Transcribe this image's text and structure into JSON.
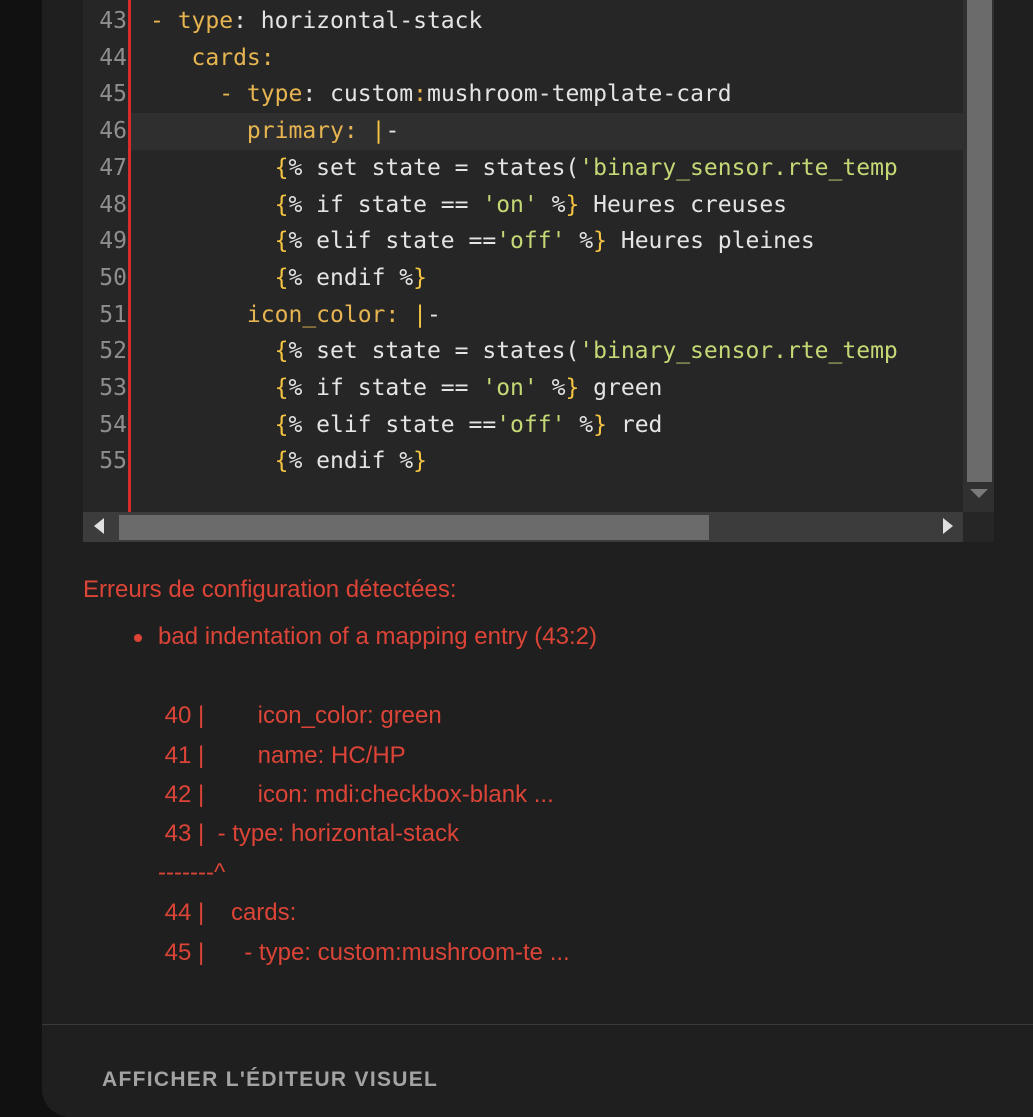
{
  "editor": {
    "lines": [
      {
        "n": "43",
        "parts": [
          {
            "t": "- ",
            "c": "k"
          },
          {
            "t": "type",
            "c": "k"
          },
          {
            "t": ": horizontal-stack",
            "c": "p"
          }
        ]
      },
      {
        "n": "44",
        "parts": [
          {
            "t": "   cards",
            "c": "k"
          },
          {
            "t": ":",
            "c": "k"
          }
        ]
      },
      {
        "n": "45",
        "parts": [
          {
            "t": "     - type",
            "c": "k"
          },
          {
            "t": ": custom",
            "c": "p"
          },
          {
            "t": ":",
            "c": "k"
          },
          {
            "t": "mushroom-template-card",
            "c": "p"
          }
        ]
      },
      {
        "n": "46",
        "parts": [
          {
            "t": "       primary",
            "c": "k"
          },
          {
            "t": ": ",
            "c": "k"
          },
          {
            "t": "|",
            "c": "b"
          },
          {
            "t": "-",
            "c": "p"
          }
        ]
      },
      {
        "n": "47",
        "parts": [
          {
            "t": "         {",
            "c": "b"
          },
          {
            "t": "% set state = states(",
            "c": "p"
          },
          {
            "t": "'binary_sensor.rte_temp",
            "c": "s"
          }
        ]
      },
      {
        "n": "48",
        "parts": [
          {
            "t": "         {",
            "c": "b"
          },
          {
            "t": "% if state == ",
            "c": "p"
          },
          {
            "t": "'on'",
            "c": "s"
          },
          {
            "t": " %",
            "c": "p"
          },
          {
            "t": "}",
            "c": "b"
          },
          {
            "t": " Heures creuses",
            "c": "p"
          }
        ]
      },
      {
        "n": "49",
        "parts": [
          {
            "t": "         {",
            "c": "b"
          },
          {
            "t": "% elif state ==",
            "c": "p"
          },
          {
            "t": "'off'",
            "c": "s"
          },
          {
            "t": " %",
            "c": "p"
          },
          {
            "t": "}",
            "c": "b"
          },
          {
            "t": " Heures pleines",
            "c": "p"
          }
        ]
      },
      {
        "n": "50",
        "parts": [
          {
            "t": "         {",
            "c": "b"
          },
          {
            "t": "% endif %",
            "c": "p"
          },
          {
            "t": "}",
            "c": "b"
          }
        ]
      },
      {
        "n": "51",
        "parts": [
          {
            "t": "       icon_color",
            "c": "k"
          },
          {
            "t": ": ",
            "c": "k"
          },
          {
            "t": "|",
            "c": "b"
          },
          {
            "t": "-",
            "c": "p"
          }
        ]
      },
      {
        "n": "52",
        "parts": [
          {
            "t": "         {",
            "c": "b"
          },
          {
            "t": "% set state = states(",
            "c": "p"
          },
          {
            "t": "'binary_sensor.rte_temp",
            "c": "s"
          }
        ]
      },
      {
        "n": "53",
        "parts": [
          {
            "t": "         {",
            "c": "b"
          },
          {
            "t": "% if state == ",
            "c": "p"
          },
          {
            "t": "'on'",
            "c": "s"
          },
          {
            "t": " %",
            "c": "p"
          },
          {
            "t": "}",
            "c": "b"
          },
          {
            "t": " green",
            "c": "p"
          }
        ]
      },
      {
        "n": "54",
        "parts": [
          {
            "t": "         {",
            "c": "b"
          },
          {
            "t": "% elif state ==",
            "c": "p"
          },
          {
            "t": "'off'",
            "c": "s"
          },
          {
            "t": " %",
            "c": "p"
          },
          {
            "t": "}",
            "c": "b"
          },
          {
            "t": " red",
            "c": "p"
          }
        ]
      },
      {
        "n": "55",
        "parts": [
          {
            "t": "         {",
            "c": "b"
          },
          {
            "t": "% endif %",
            "c": "p"
          },
          {
            "t": "}",
            "c": "b"
          }
        ]
      }
    ]
  },
  "errors": {
    "title": "Erreurs de configuration détectées:",
    "message": "bad indentation of a mapping entry (43:2)",
    "snippet": [
      " 40 |        icon_color: green",
      " 41 |        name: HC/HP",
      " 42 |        icon: mdi:checkbox-blank ...",
      " 43 |  - type: horizontal-stack",
      "-------^",
      " 44 |    cards:",
      " 45 |      - type: custom:mushroom-te ..."
    ]
  },
  "footer": {
    "visual_editor_label": "AFFICHER L'ÉDITEUR VISUEL"
  },
  "colors": {
    "error": "#db4437",
    "gutter_error": "#d92b2b",
    "yaml_key": "#e6b450",
    "yaml_string": "#c4d976"
  }
}
